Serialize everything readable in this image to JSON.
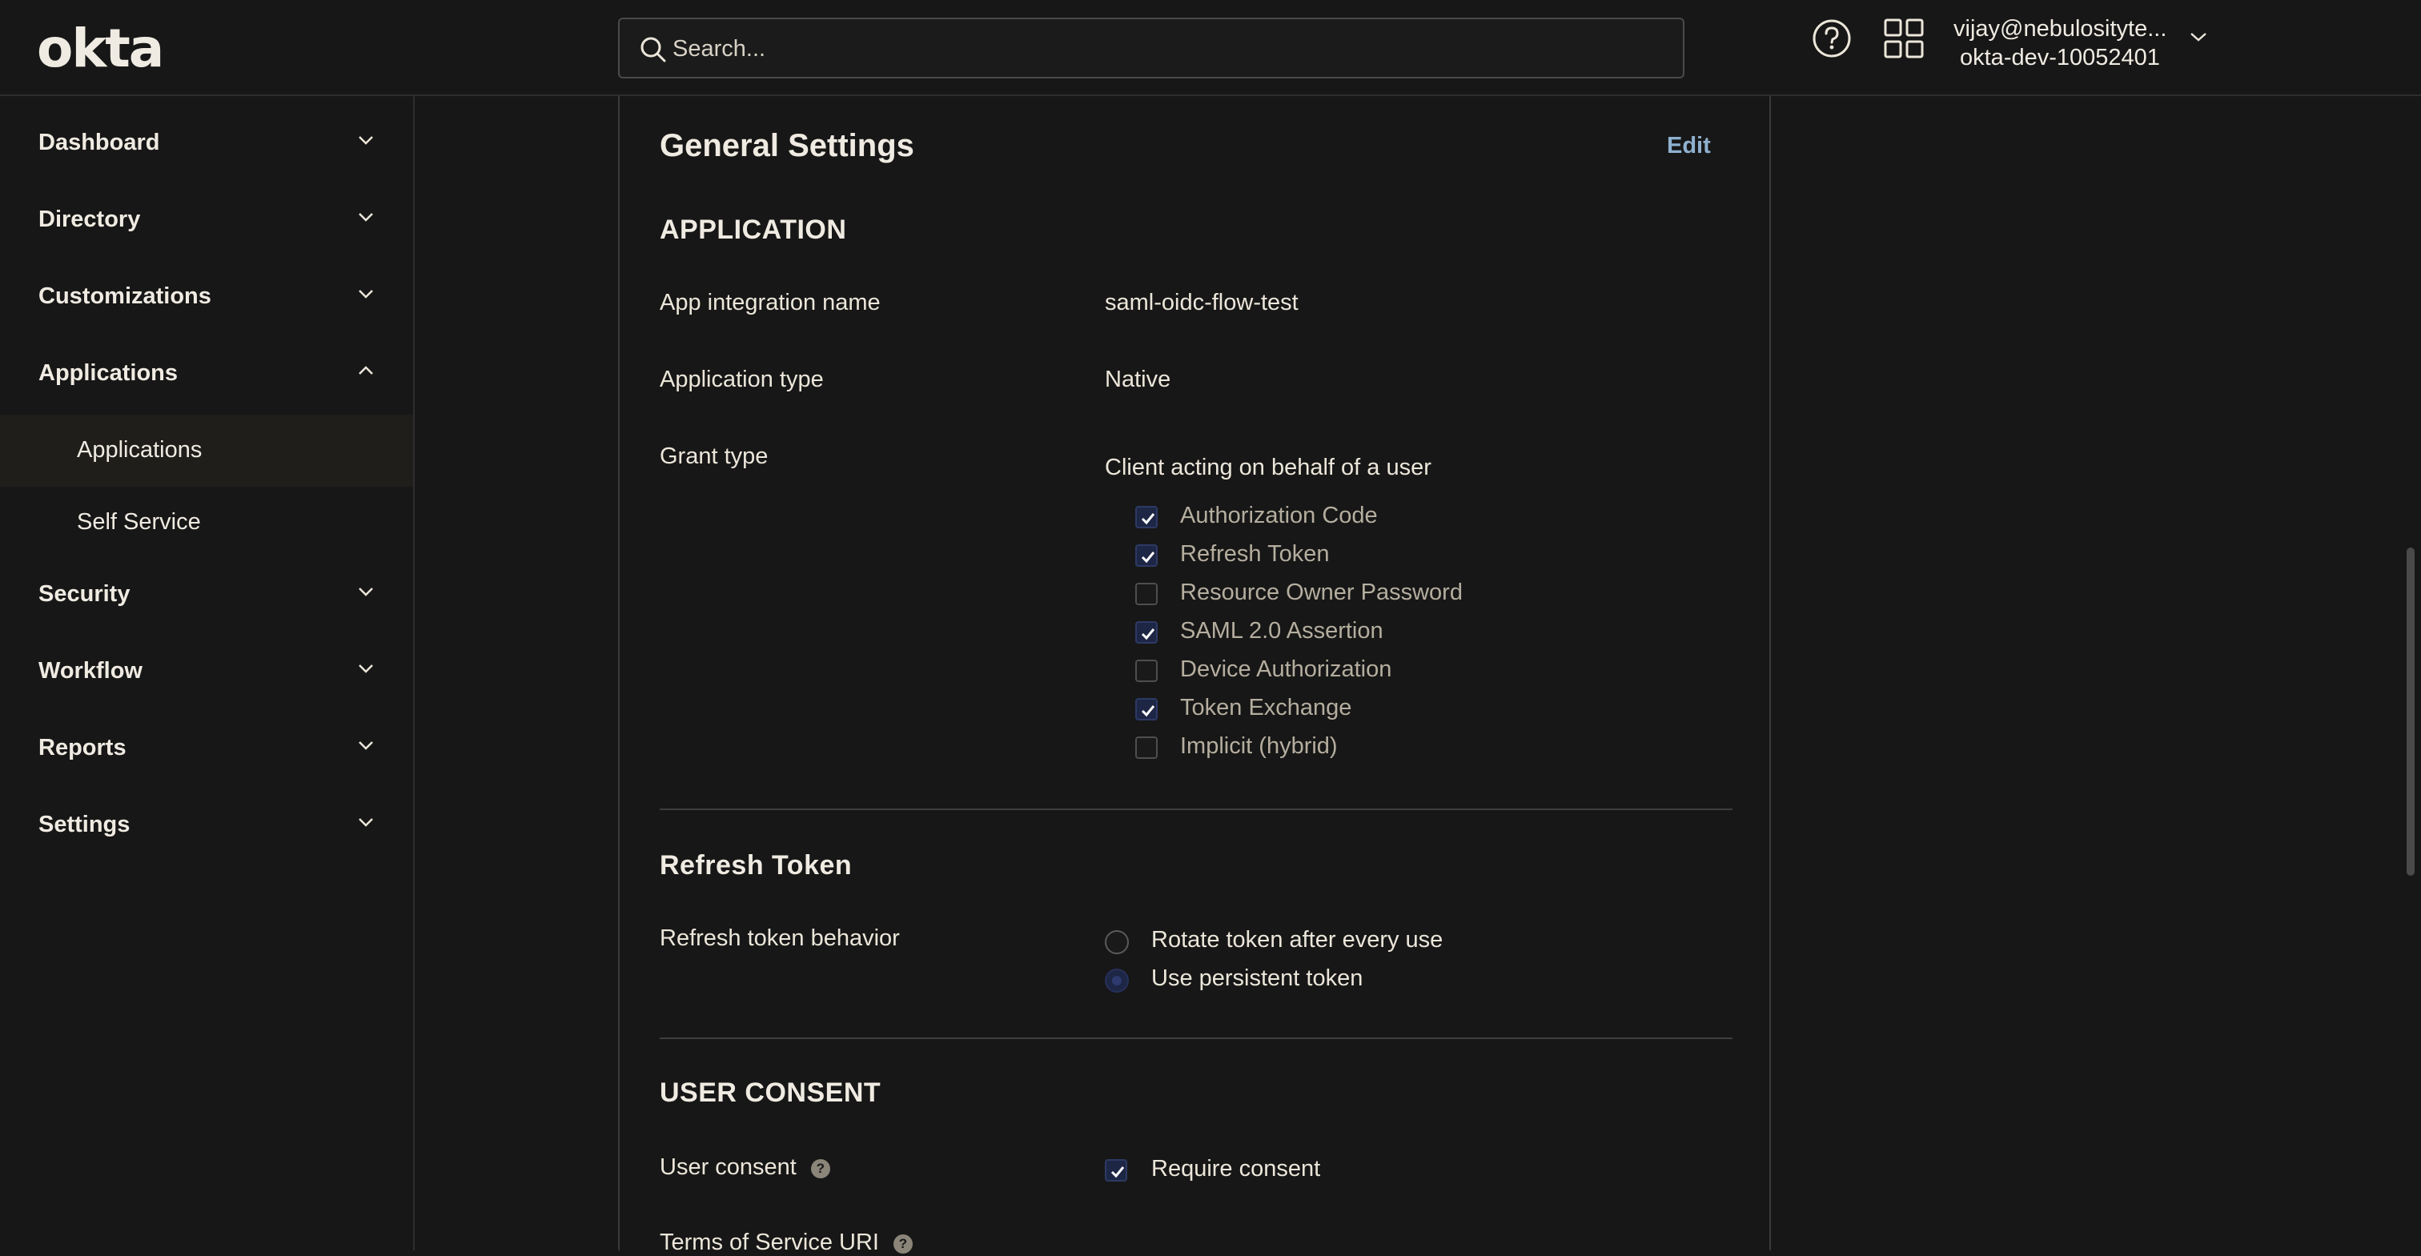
{
  "brand": {
    "logo_text": "okta"
  },
  "search": {
    "placeholder": "Search..."
  },
  "user": {
    "email": "vijay@nebulosityte...",
    "org": "okta-dev-10052401"
  },
  "sidebar": {
    "items": [
      {
        "label": "Dashboard",
        "expanded": false
      },
      {
        "label": "Directory",
        "expanded": false
      },
      {
        "label": "Customizations",
        "expanded": false
      },
      {
        "label": "Applications",
        "expanded": true,
        "children": [
          {
            "label": "Applications",
            "active": true
          },
          {
            "label": "Self Service",
            "active": false
          }
        ]
      },
      {
        "label": "Security",
        "expanded": false
      },
      {
        "label": "Workflow",
        "expanded": false
      },
      {
        "label": "Reports",
        "expanded": false
      },
      {
        "label": "Settings",
        "expanded": false
      }
    ]
  },
  "main": {
    "title": "General Settings",
    "edit_label": "Edit",
    "application": {
      "heading": "APPLICATION",
      "name_label": "App integration name",
      "name_value": "saml-oidc-flow-test",
      "type_label": "Application type",
      "type_value": "Native",
      "grant_label": "Grant type",
      "grant_subheading": "Client acting on behalf of a user",
      "grants": [
        {
          "label": "Authorization Code",
          "checked": true
        },
        {
          "label": "Refresh Token",
          "checked": true
        },
        {
          "label": "Resource Owner Password",
          "checked": false
        },
        {
          "label": "SAML 2.0 Assertion",
          "checked": true
        },
        {
          "label": "Device Authorization",
          "checked": false
        },
        {
          "label": "Token Exchange",
          "checked": true
        },
        {
          "label": "Implicit (hybrid)",
          "checked": false
        }
      ]
    },
    "refresh_token": {
      "heading": "Refresh Token",
      "behavior_label": "Refresh token behavior",
      "options": [
        {
          "label": "Rotate token after every use",
          "selected": false
        },
        {
          "label": "Use persistent token",
          "selected": true
        }
      ]
    },
    "user_consent": {
      "heading": "USER CONSENT",
      "consent_label": "User consent",
      "require_label": "Require consent",
      "require_checked": true,
      "tos_label": "Terms of Service URI",
      "help_glyph": "?"
    }
  },
  "colors": {
    "background": "#171717",
    "text": "#ece6da",
    "link": "#8fb0d0",
    "checkbox_checked": "#1e2645"
  }
}
